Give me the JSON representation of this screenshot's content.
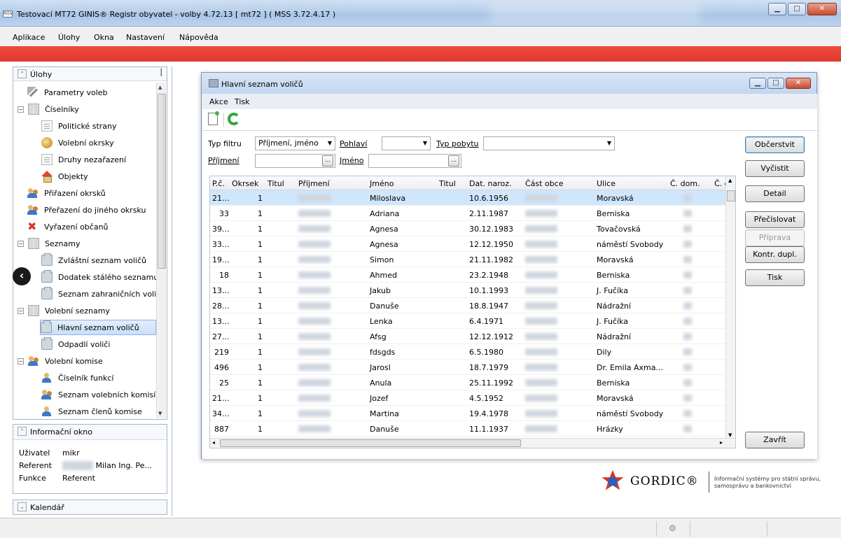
{
  "app": {
    "title": "Testovací MT72 GINIS® Registr obyvatel - volby 4.72.13 [ mt72 ] ( MSS 3.72.4.17 )",
    "icon_label": "RGV"
  },
  "menu": [
    "Aplikace",
    "Úlohy",
    "Okna",
    "Nastavení",
    "Nápověda"
  ],
  "left_panel": {
    "title": "Úlohy",
    "items": [
      {
        "label": "Parametry voleb",
        "icon": "tools-icon"
      },
      {
        "label": "Číselníky",
        "icon": "book-icon",
        "expander": "−"
      },
      {
        "label": "Politické strany",
        "icon": "document-icon"
      },
      {
        "label": "Volební okrsky",
        "icon": "globe-icon"
      },
      {
        "label": "Druhy nezařazení",
        "icon": "document-icon"
      },
      {
        "label": "Objekty",
        "icon": "house-icon"
      },
      {
        "label": "Přiřazení okrsků",
        "icon": "people-icon"
      },
      {
        "label": "Přeřazení do jiného okrsku",
        "icon": "people-icon"
      },
      {
        "label": "Vyřazení občanů",
        "icon": "remove-people-icon"
      },
      {
        "label": "Seznamy",
        "icon": "book-icon",
        "expander": "−"
      },
      {
        "label": "Zvláštní seznam voličů",
        "icon": "folder-icon"
      },
      {
        "label": "Dodatek stálého seznamu",
        "icon": "folder-icon"
      },
      {
        "label": "Seznam zahraničních voličů",
        "icon": "folder-icon"
      },
      {
        "label": "Volební seznamy",
        "icon": "book-icon",
        "expander": "−"
      },
      {
        "label": "Hlavní seznam voličů",
        "icon": "folder-icon"
      },
      {
        "label": "Odpadlí voliči",
        "icon": "folder-icon"
      },
      {
        "label": "Volební komise",
        "icon": "people-icon",
        "expander": "−"
      },
      {
        "label": "Číselník funkcí",
        "icon": "person-icon"
      },
      {
        "label": "Seznam volebních komisí",
        "icon": "people-icon"
      },
      {
        "label": "Seznam členů komise",
        "icon": "person-icon"
      }
    ]
  },
  "info_panel": {
    "title": "Informační okno",
    "rows": [
      {
        "key": "Uživatel",
        "value": "mikr"
      },
      {
        "key": "Referent",
        "value": "Milan Ing. Pe..."
      },
      {
        "key": "Funkce",
        "value": "Referent"
      }
    ]
  },
  "calendar_panel": {
    "title": "Kalendář"
  },
  "inner_window": {
    "title": "Hlavní seznam voličů",
    "menu": [
      "Akce",
      "Tisk"
    ],
    "filters": {
      "typ_filtru_label": "Typ filtru",
      "typ_filtru_value": "Příjmení, jméno",
      "pohlavi_label": "Pohlaví",
      "pohlavi_value": "",
      "typ_pobytu_label": "Typ pobytu",
      "typ_pobytu_value": "",
      "prijmeni_label": "Příjmení",
      "prijmeni_value": "",
      "jmeno_label": "Jméno",
      "jmeno_value": "",
      "browse_label": "..."
    },
    "columns": [
      "P.č.",
      "Okrsek",
      "Titul",
      "Příjmení",
      "Jméno",
      "Titul",
      "Dat. naroz.",
      "Část obce",
      "Ulice",
      "Č. dom.",
      "Č. o"
    ],
    "rows": [
      {
        "pc": "21...",
        "okrsek": "1",
        "jmeno": "Miloslava",
        "narozeni": "10.6.1956",
        "ulice": "Moravská"
      },
      {
        "pc": "33",
        "okrsek": "1",
        "jmeno": "Adriana",
        "narozeni": "2.11.1987",
        "ulice": "Berniska"
      },
      {
        "pc": "39...",
        "okrsek": "1",
        "jmeno": "Agnesa",
        "narozeni": "30.12.1983",
        "ulice": "Tovačovská"
      },
      {
        "pc": "33...",
        "okrsek": "1",
        "jmeno": "Agnesa",
        "narozeni": "12.12.1950",
        "ulice": "náměstí Svobody"
      },
      {
        "pc": "19...",
        "okrsek": "1",
        "jmeno": "Simon",
        "narozeni": "21.11.1982",
        "ulice": "Moravská"
      },
      {
        "pc": "18",
        "okrsek": "1",
        "jmeno": "Ahmed",
        "narozeni": "23.2.1948",
        "ulice": "Berniska"
      },
      {
        "pc": "13...",
        "okrsek": "1",
        "jmeno": "Jakub",
        "narozeni": "10.1.1993",
        "ulice": "J. Fučíka"
      },
      {
        "pc": "28...",
        "okrsek": "1",
        "jmeno": "Danuše",
        "narozeni": "18.8.1947",
        "ulice": "Nádražní"
      },
      {
        "pc": "13...",
        "okrsek": "1",
        "jmeno": "Lenka",
        "narozeni": "6.4.1971",
        "ulice": "J. Fučíka"
      },
      {
        "pc": "27...",
        "okrsek": "1",
        "jmeno": "Afsg",
        "narozeni": "12.12.1912",
        "ulice": "Nádražní"
      },
      {
        "pc": "219",
        "okrsek": "1",
        "jmeno": "fdsgds",
        "narozeni": "6.5.1980",
        "ulice": "Dily"
      },
      {
        "pc": "496",
        "okrsek": "1",
        "jmeno": "Jarosl",
        "narozeni": "18.7.1979",
        "ulice": "Dr. Emila Axma..."
      },
      {
        "pc": "25",
        "okrsek": "1",
        "jmeno": "Anula",
        "narozeni": "25.11.1992",
        "ulice": "Berniska"
      },
      {
        "pc": "21...",
        "okrsek": "1",
        "jmeno": "Jozef",
        "narozeni": "4.5.1952",
        "ulice": "Moravská"
      },
      {
        "pc": "34...",
        "okrsek": "1",
        "jmeno": "Martina",
        "narozeni": "19.4.1978",
        "ulice": "náměstí Svobody"
      },
      {
        "pc": "887",
        "okrsek": "1",
        "jmeno": "Danuše",
        "narozeni": "11.1.1937",
        "ulice": "Hrázky"
      }
    ],
    "buttons": [
      "Občerstvit",
      "Vyčistit",
      "Detail",
      "Přečíslovat",
      "Příprava",
      "Kontr. dupl.",
      "Tisk",
      "Zavřít"
    ]
  },
  "logo": {
    "name": "GORDIC®",
    "tagline_1": "Informační systémy pro státní správu,",
    "tagline_2": "samosprávu a bankovnictví"
  }
}
